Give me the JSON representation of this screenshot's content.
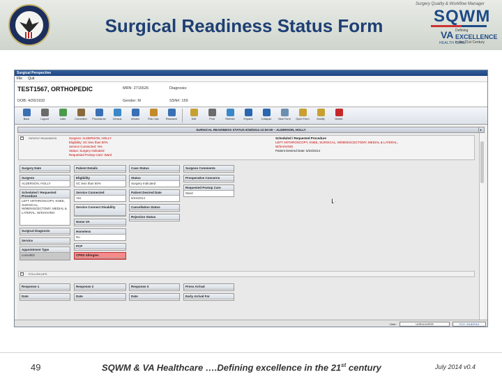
{
  "slide": {
    "title": "Surgical Readiness Status Form",
    "brand_tagline": "Surgery Quality & Workflow Manager",
    "brand_logo": "SQWM",
    "va_logo": "VA",
    "va_care": "HEALTH CARE",
    "excellence_pre": "Defining",
    "excellence_word": "EXCELLENCE",
    "excellence_post": "in the 21st Century",
    "page_number": "49",
    "footer_main": "SQWM & VA Healthcare ….Defining excellence in the 21",
    "footer_sup": "st",
    "footer_end": " century",
    "footer_date": "July 2014  v0.4"
  },
  "app": {
    "title": "Surgical Perspective",
    "menu": [
      "File",
      "Quit"
    ],
    "patient": {
      "name": "TEST1567, ORTHOPEDIC",
      "mrn": "MRN: 2716526",
      "dob": "DOB: 4/26/1932",
      "gender": "Gender: M",
      "diagnosis": "Diagnosis:",
      "ssn": "SSN#: 159"
    },
    "toolbar": [
      {
        "label": "Back",
        "color": "#3a6fb5"
      },
      {
        "label": "Logout",
        "color": "#6b6b6b"
      },
      {
        "label": "Labs",
        "color": "#4c9a4c"
      },
      {
        "label": "Correction",
        "color": "#8a6a3a"
      },
      {
        "label": "Procedures",
        "color": "#3a6fb5"
      },
      {
        "label": "Census",
        "color": "#3a88c8"
      },
      {
        "label": "eNotes",
        "color": "#3a6fb5"
      },
      {
        "label": "Pick Calc",
        "color": "#c48a2a"
      },
      {
        "label": "Research",
        "color": "#3a6fb5"
      },
      {
        "label": "Edit",
        "color": "#c8a032"
      },
      {
        "label": "Print",
        "color": "#6b6b6b"
      },
      {
        "label": "Refresh",
        "color": "#3a88c8"
      },
      {
        "label": "Expand",
        "color": "#2a66b0"
      },
      {
        "label": "Collapse",
        "color": "#2a66b0"
      },
      {
        "label": "New Form",
        "color": "#6b8fb0"
      },
      {
        "label": "Open Form",
        "color": "#c8a032"
      },
      {
        "label": "Modify",
        "color": "#c8a032"
      },
      {
        "label": "Delete",
        "color": "#c62828"
      }
    ],
    "form_bar": "SURGICAL READINESS STATUS 6/18/2014 12:00:00 – ALDERSON, HOLLY",
    "summary": {
      "label": "PATIENT READINESS",
      "surgeon": "Surgeon: ALDERSON, HOLLY",
      "eligibility": "Eligibility: SC less than 50%",
      "service": "Service Connected: Yes",
      "status": "Status: Surgery Indicated",
      "postop": "Requested Postop Care: Ward",
      "sched_label": "Scheduled / Requested Procedure",
      "procedure_1": "LEFT ARTHROSCOPY, KNEE, SURGICAL, W/MENISCECTOMY, MEDIAL & LATERAL,",
      "procedure_2": "W/SHAVING",
      "desired": "Patient Desired Date: 6/24/2014"
    },
    "col1": {
      "surgery_date": "Surgery Date",
      "surgeon_h": "Surgeon",
      "surgeon_v": "ALDERSON, HOLLY",
      "sched_h": "Scheduled / Requested Procedure",
      "sched_v": "LEFT ARTHROSCOPY, KNEE, SURGICAL, W/MENISCECTOMY, MEDIAL & LATERAL, W/SHAVING",
      "diag": "Surgical Diagnosis",
      "service_h": "Service",
      "appt_h": "Appointment Type",
      "appt_v": "consultID"
    },
    "col2": {
      "patient_details": "Patient Details",
      "eligibility_h": "Eligibility",
      "eligibility_v": "SC less than 50%",
      "sc_h": "Service Connected",
      "sc_v": "Yes",
      "scd_h": "Service Connect Disability",
      "home_va": "Home VA",
      "homeless_h": "Homeless",
      "homeless_v": "No",
      "pcp": "PCP",
      "allergies": "CPRS Allergies"
    },
    "col3": {
      "case_status": "Case Status",
      "status_h": "Status",
      "status_v": "Surgery Indicated",
      "desired_h": "Patient Desired Date",
      "desired_v": "6/24/2014",
      "cancel": "Cancellation Status",
      "reject": "Rejection Status"
    },
    "col4": {
      "comments": "Surgeon Comments",
      "concerns": "Preoperative Concerns",
      "postop_h": "Requested Postop Care",
      "postop_v": "Ward"
    },
    "section2_label": "FOLLOW-UPS",
    "response": [
      {
        "header": "Response 1",
        "value": "Date"
      },
      {
        "header": "Response 2",
        "value": "Date"
      },
      {
        "header": "Response 3",
        "value": "Date"
      },
      {
        "header": "Press Arrival",
        "value": "Early Arrival For"
      }
    ],
    "status_bar": {
      "user_label": "User:",
      "user": "USR\\XXXFER",
      "date": "FCC: 6/18/2014"
    }
  }
}
